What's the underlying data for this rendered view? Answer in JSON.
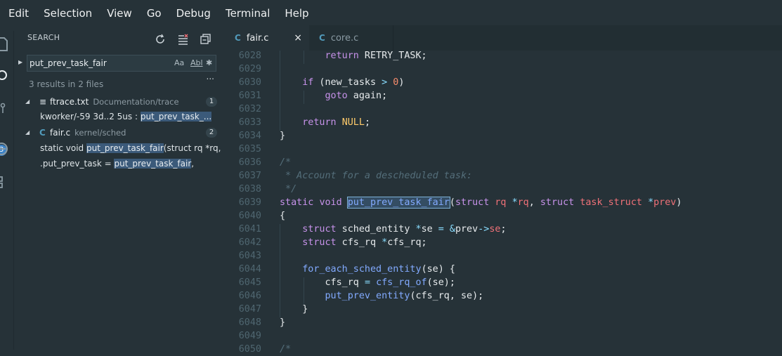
{
  "menu": [
    "Edit",
    "Selection",
    "View",
    "Go",
    "Debug",
    "Terminal",
    "Help"
  ],
  "activity": {
    "badge": "3"
  },
  "sidebar": {
    "title": "SEARCH",
    "search_value": "put_prev_task_fair",
    "opt_case": "Aa",
    "opt_word": "Abl",
    "opt_regex": "✱",
    "result_count": "3 results in 2 files",
    "files": [
      {
        "icon": "≡",
        "name": "ftrace.txt",
        "path": "Documentation/trace",
        "count": "1",
        "matches": [
          {
            "pre": "kworker/-59      3d..2    5us : ",
            "hit": "put_prev_task_...",
            "post": ""
          }
        ]
      },
      {
        "icon": "C",
        "name": "fair.c",
        "path": "kernel/sched",
        "count": "2",
        "matches": [
          {
            "pre": "static void ",
            "hit": "put_prev_task_fair",
            "post": "(struct rq *rq, ..."
          },
          {
            "pre": ".put_prev_task            = ",
            "hit": "put_prev_task_fair",
            "post": ","
          }
        ]
      }
    ],
    "more": "..."
  },
  "tabs": [
    {
      "icon": "C",
      "label": "fair.c",
      "active": true,
      "close": "×"
    },
    {
      "icon": "C",
      "label": "core.c",
      "active": false
    }
  ],
  "lines": [
    {
      "n": "6028",
      "html": "        <span class='kw'>return</span> RETRY_TASK;"
    },
    {
      "n": "6029",
      "html": ""
    },
    {
      "n": "6030",
      "html": "    <span class='kw'>if</span> (new_tasks <span class='op'>&gt;</span> <span class='num'>0</span>)"
    },
    {
      "n": "6031",
      "html": "        <span class='kw'>goto</span> again;"
    },
    {
      "n": "6032",
      "html": ""
    },
    {
      "n": "6033",
      "html": "    <span class='kw'>return</span> <span class='mac'>NULL</span>;"
    },
    {
      "n": "6034",
      "html": "}"
    },
    {
      "n": "6035",
      "html": ""
    },
    {
      "n": "6036",
      "html": "<span class='cmt'>/*</span>"
    },
    {
      "n": "6037",
      "html": "<span class='cmt'> * Account for a descheduled task:</span>"
    },
    {
      "n": "6038",
      "html": "<span class='cmt'> */</span>"
    },
    {
      "n": "6039",
      "html": "<span class='kw'>static</span> <span class='type'>void</span> <span class='boxhl'>put_prev_task_fair</span>(<span class='type'>struct</span> <span class='var'>rq</span> <span class='op'>*</span><span class='var'>rq</span>, <span class='type'>struct</span> <span class='var'>task_struct</span> <span class='op'>*</span><span class='var'>prev</span>)"
    },
    {
      "n": "6040",
      "html": "{"
    },
    {
      "n": "6041",
      "html": "    <span class='type'>struct</span> sched_entity <span class='op'>*</span>se <span class='op'>=</span> <span class='op'>&amp;</span>prev<span class='op'>-&gt;</span><span class='var'>se</span>;"
    },
    {
      "n": "6042",
      "html": "    <span class='type'>struct</span> cfs_rq <span class='op'>*</span>cfs_rq;"
    },
    {
      "n": "6043",
      "html": ""
    },
    {
      "n": "6044",
      "html": "    <span class='fn'>for_each_sched_entity</span>(se) {"
    },
    {
      "n": "6045",
      "html": "        cfs_rq <span class='op'>=</span> <span class='fn'>cfs_rq_of</span>(se);"
    },
    {
      "n": "6046",
      "html": "        <span class='fn'>put_prev_entity</span>(cfs_rq, se);"
    },
    {
      "n": "6047",
      "html": "    }"
    },
    {
      "n": "6048",
      "html": "}"
    },
    {
      "n": "6049",
      "html": ""
    },
    {
      "n": "6050",
      "html": "<span class='cmt'>/*</span>"
    }
  ]
}
